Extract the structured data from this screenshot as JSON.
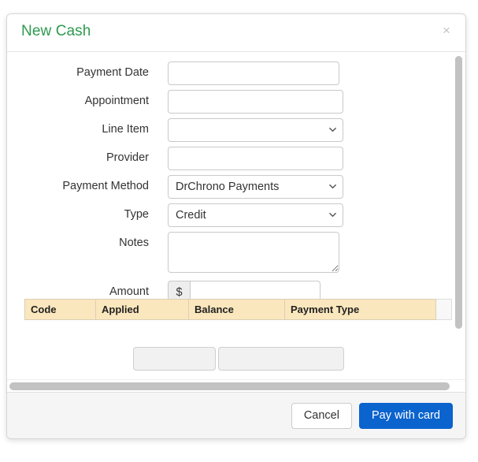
{
  "modal": {
    "title": "New Cash",
    "close_icon": "close-icon",
    "close_label": "×"
  },
  "form": {
    "fields": [
      {
        "label": "Payment Date",
        "type": "text",
        "value": "",
        "placeholder": ""
      },
      {
        "label": "Appointment",
        "type": "text",
        "value": "",
        "placeholder": ""
      },
      {
        "label": "Line Item",
        "type": "select",
        "value": "",
        "placeholder": ""
      },
      {
        "label": "Provider",
        "type": "text",
        "value": "",
        "placeholder": ""
      },
      {
        "label": "Payment Method",
        "type": "select",
        "value": "DrChrono Payments",
        "placeholder": ""
      },
      {
        "label": "Type",
        "type": "select",
        "value": "Credit",
        "placeholder": ""
      },
      {
        "label": "Notes",
        "type": "textarea",
        "value": "",
        "placeholder": ""
      },
      {
        "label": "Amount",
        "type": "currency",
        "value": "",
        "placeholder": "",
        "prefix": "$"
      }
    ],
    "payment_method_options": [
      "DrChrono Payments"
    ],
    "type_options": [
      "Credit"
    ]
  },
  "table": {
    "columns": [
      "Code",
      "Applied",
      "Balance",
      "Payment Type"
    ]
  },
  "footer": {
    "cancel_label": "Cancel",
    "pay_label": "Pay with card"
  },
  "colors": {
    "title_green": "#2d9a4e",
    "primary_blue": "#0b63ce",
    "table_header": "#fbe7bd"
  }
}
